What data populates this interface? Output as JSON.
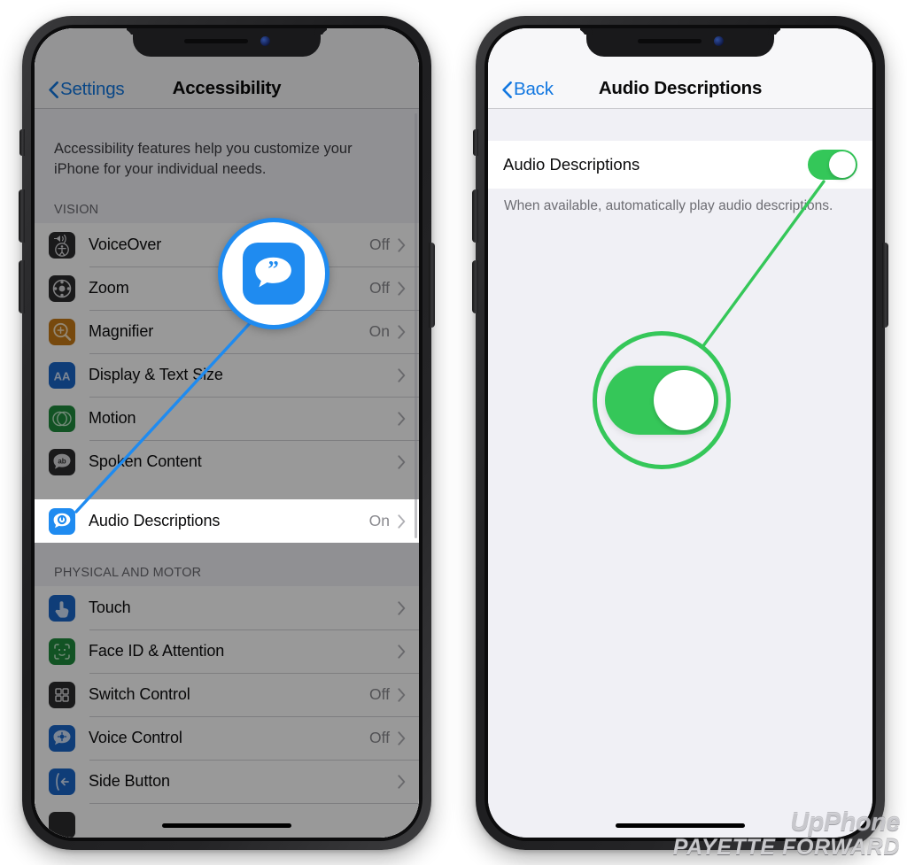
{
  "left_phone": {
    "nav": {
      "back_label": "Settings",
      "title": "Accessibility"
    },
    "intro": "Accessibility features help you customize your iPhone for your individual needs.",
    "sections": [
      {
        "header": "VISION",
        "rows": [
          {
            "label": "VoiceOver",
            "value": "Off",
            "icon": "voiceover-icon",
            "icon_bg": "#2c2c2e"
          },
          {
            "label": "Zoom",
            "value": "Off",
            "icon": "zoom-icon",
            "icon_bg": "#2c2c2e"
          },
          {
            "label": "Magnifier",
            "value": "On",
            "icon": "magnifier-icon",
            "icon_bg": "#c77a16"
          },
          {
            "label": "Display & Text Size",
            "value": "",
            "icon": "display-text-icon",
            "icon_bg": "#1a66c9"
          },
          {
            "label": "Motion",
            "value": "",
            "icon": "motion-icon",
            "icon_bg": "#1f8a3c"
          },
          {
            "label": "Spoken Content",
            "value": "",
            "icon": "spoken-content-icon",
            "icon_bg": "#2c2c2e"
          },
          {
            "label": "Audio Descriptions",
            "value": "On",
            "icon": "audio-descriptions-icon",
            "icon_bg": "#1f8bf0",
            "highlighted": true
          }
        ]
      },
      {
        "header": "PHYSICAL AND MOTOR",
        "rows": [
          {
            "label": "Touch",
            "value": "",
            "icon": "touch-icon",
            "icon_bg": "#1a66c9"
          },
          {
            "label": "Face ID & Attention",
            "value": "",
            "icon": "face-id-icon",
            "icon_bg": "#1f8a3c"
          },
          {
            "label": "Switch Control",
            "value": "Off",
            "icon": "switch-control-icon",
            "icon_bg": "#2c2c2e"
          },
          {
            "label": "Voice Control",
            "value": "Off",
            "icon": "voice-control-icon",
            "icon_bg": "#1a66c9"
          },
          {
            "label": "Side Button",
            "value": "",
            "icon": "side-button-icon",
            "icon_bg": "#1a66c9"
          }
        ]
      }
    ]
  },
  "right_phone": {
    "nav": {
      "back_label": "Back",
      "title": "Audio Descriptions"
    },
    "toggle_row": {
      "label": "Audio Descriptions",
      "state": "on"
    },
    "footer": "When available, automatically play audio descriptions."
  },
  "callouts": {
    "blue": {
      "icon": "audio-descriptions-app-icon",
      "accent": "#1f8bf0"
    },
    "green": {
      "icon": "toggle-switch-on",
      "accent": "#35c759"
    }
  },
  "watermark": {
    "line1": "UpPhone",
    "line2": "PAYETTE FORWARD"
  }
}
